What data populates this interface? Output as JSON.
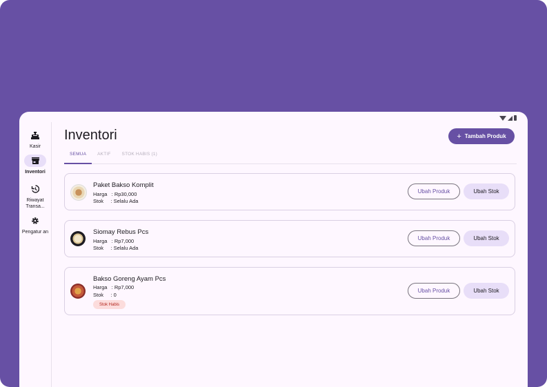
{
  "colors": {
    "primary": "#6750A4",
    "secondary_container": "#E8DEF8",
    "surface": "#FEF7FF",
    "error_container": "#FCDCDC",
    "error": "#B3261E"
  },
  "rail": {
    "items": [
      {
        "label": "Kasir",
        "icon": "cash-register-icon",
        "active": false
      },
      {
        "label": "Inventori",
        "icon": "store-icon",
        "active": true
      },
      {
        "label": "Riwayat Transa...",
        "icon": "history-icon",
        "active": false
      },
      {
        "label": "Pengatur an",
        "icon": "gear-icon",
        "active": false
      }
    ]
  },
  "header": {
    "title": "Inventori",
    "add_button": "Tambah Produk",
    "add_icon": "+"
  },
  "tabs": [
    {
      "label": "SEMUA",
      "active": true
    },
    {
      "label": "AKTIF",
      "active": false
    },
    {
      "label": "STOK HABIS (1)",
      "active": false
    }
  ],
  "products": [
    {
      "name": "Paket Bakso Komplit",
      "price_line": "Harga   : Rp30,000",
      "stock_line": "Stok     : Selalu Ada",
      "badge": "",
      "edit_label": "Ubah Produk",
      "stock_label": "Ubah Stok"
    },
    {
      "name": "Siomay Rebus Pcs",
      "price_line": "Harga   : Rp7,000",
      "stock_line": "Stok     : Selalu Ada",
      "badge": "",
      "edit_label": "Ubah Produk",
      "stock_label": "Ubah Stok"
    },
    {
      "name": "Bakso Goreng Ayam Pcs",
      "price_line": "Harga   : Rp7,000",
      "stock_line": "Stok     : 0",
      "badge": "Stok Habis",
      "edit_label": "Ubah Produk",
      "stock_label": "Ubah Stok"
    }
  ]
}
